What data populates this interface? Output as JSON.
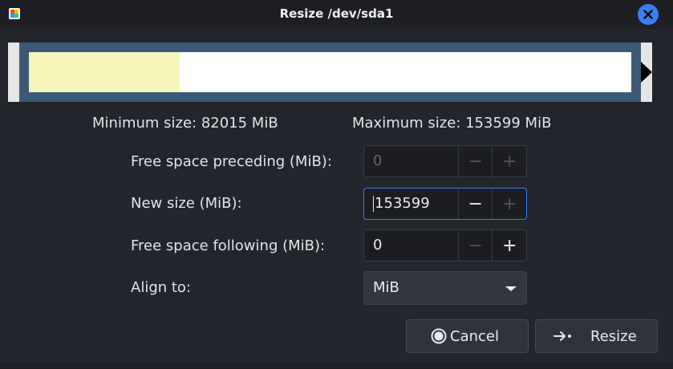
{
  "window": {
    "title": "Resize /dev/sda1",
    "app_icon": "gparted-app-icon",
    "close_icon": "close-icon"
  },
  "partition_graphic": {
    "used_fraction": 0.25,
    "used_color": "#f5f5b7",
    "border_color": "#3c5a78",
    "handle_icon": "resize-arrow-right-icon"
  },
  "sizes": {
    "minimum_label": "Minimum size: 82015 MiB",
    "maximum_label": "Maximum size: 153599 MiB"
  },
  "fields": {
    "free_preceding": {
      "label": "Free space preceding (MiB):",
      "value": "0",
      "minus": "−",
      "plus": "+"
    },
    "new_size": {
      "label": "New size (MiB):",
      "value": "153599",
      "minus": "−",
      "plus": "+"
    },
    "free_following": {
      "label": "Free space following (MiB):",
      "value": "0",
      "minus": "−",
      "plus": "+"
    },
    "align_to": {
      "label": "Align to:",
      "value": "MiB"
    }
  },
  "buttons": {
    "cancel": "Cancel",
    "resize": "Resize"
  },
  "colors": {
    "accent": "#3a7ef2",
    "background": "#23252c"
  }
}
